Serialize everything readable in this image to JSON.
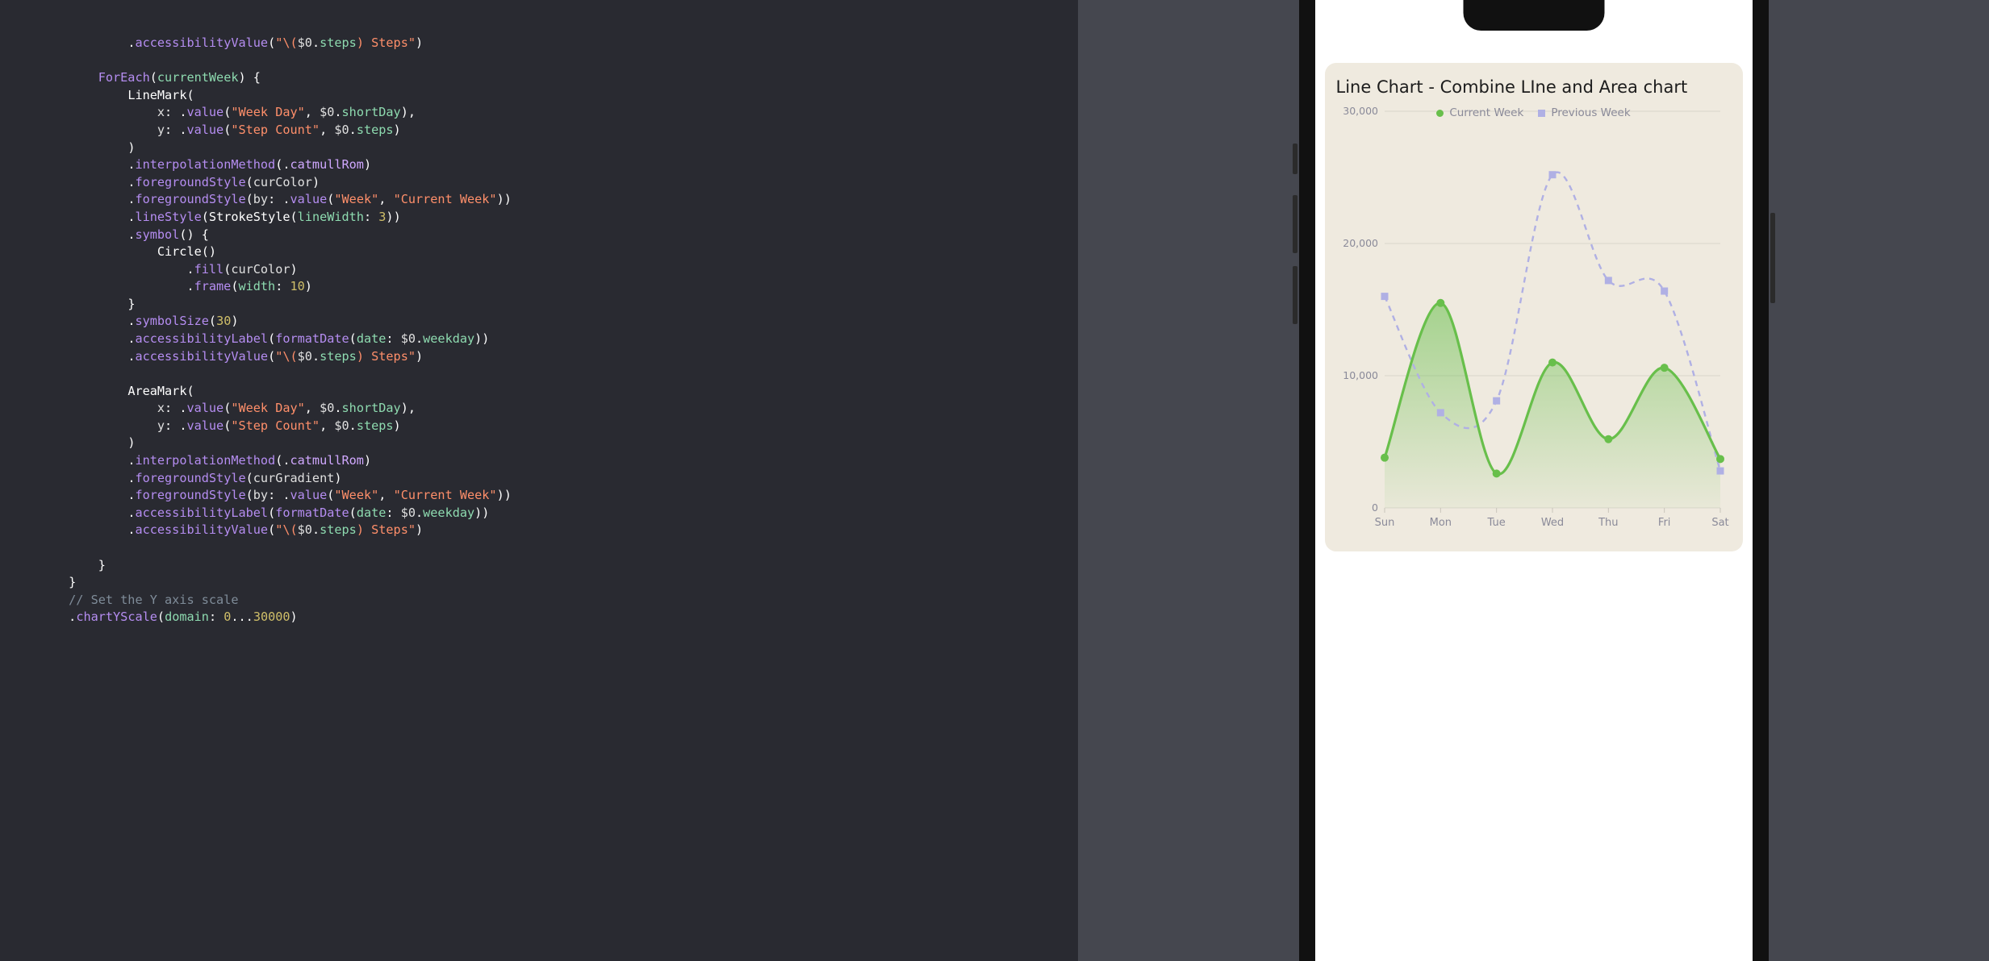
{
  "code": {
    "lines": [
      [
        [
          "                ",
          "punct"
        ],
        [
          ".",
          "punct"
        ],
        [
          "accessibilityValue",
          "fn"
        ],
        [
          "(",
          "punct"
        ],
        [
          "\"\\(",
          "str"
        ],
        [
          "$0",
          "id"
        ],
        [
          ".",
          "punct"
        ],
        [
          "steps",
          "prop"
        ],
        [
          ") Steps\"",
          "str"
        ],
        [
          ")",
          "punct"
        ]
      ],
      [],
      [
        [
          "            ",
          "punct"
        ],
        [
          "ForEach",
          "fn"
        ],
        [
          "(",
          "punct"
        ],
        [
          "currentWeek",
          "prop"
        ],
        [
          ") {",
          "punct"
        ]
      ],
      [
        [
          "                ",
          "punct"
        ],
        [
          "LineMark",
          "swift"
        ],
        [
          "(",
          "punct"
        ]
      ],
      [
        [
          "                    ",
          "punct"
        ],
        [
          "x",
          "id"
        ],
        [
          ": .",
          "punct"
        ],
        [
          "value",
          "fn"
        ],
        [
          "(",
          "punct"
        ],
        [
          "\"Week Day\"",
          "str"
        ],
        [
          ", ",
          "punct"
        ],
        [
          "$0",
          "id"
        ],
        [
          ".",
          "punct"
        ],
        [
          "shortDay",
          "prop"
        ],
        [
          "),",
          "punct"
        ]
      ],
      [
        [
          "                    ",
          "punct"
        ],
        [
          "y",
          "id"
        ],
        [
          ": .",
          "punct"
        ],
        [
          "value",
          "fn"
        ],
        [
          "(",
          "punct"
        ],
        [
          "\"Step Count\"",
          "str"
        ],
        [
          ", ",
          "punct"
        ],
        [
          "$0",
          "id"
        ],
        [
          ".",
          "punct"
        ],
        [
          "steps",
          "prop"
        ],
        [
          ")",
          "punct"
        ]
      ],
      [
        [
          "                ",
          "punct"
        ],
        [
          ")",
          "punct"
        ]
      ],
      [
        [
          "                ",
          "punct"
        ],
        [
          ".",
          "punct"
        ],
        [
          "interpolationMethod",
          "fn"
        ],
        [
          "(.",
          "punct"
        ],
        [
          "catmullRom",
          "enum"
        ],
        [
          ")",
          "punct"
        ]
      ],
      [
        [
          "                ",
          "punct"
        ],
        [
          ".",
          "punct"
        ],
        [
          "foregroundStyle",
          "fn"
        ],
        [
          "(",
          "punct"
        ],
        [
          "curColor",
          "id"
        ],
        [
          ")",
          "punct"
        ]
      ],
      [
        [
          "                ",
          "punct"
        ],
        [
          ".",
          "punct"
        ],
        [
          "foregroundStyle",
          "fn"
        ],
        [
          "(",
          "punct"
        ],
        [
          "by",
          "id"
        ],
        [
          ": .",
          "punct"
        ],
        [
          "value",
          "fn"
        ],
        [
          "(",
          "punct"
        ],
        [
          "\"Week\"",
          "str"
        ],
        [
          ", ",
          "punct"
        ],
        [
          "\"Current Week\"",
          "str"
        ],
        [
          "))",
          "punct"
        ]
      ],
      [
        [
          "                ",
          "punct"
        ],
        [
          ".",
          "punct"
        ],
        [
          "lineStyle",
          "fn"
        ],
        [
          "(",
          "punct"
        ],
        [
          "StrokeStyle",
          "swift"
        ],
        [
          "(",
          "punct"
        ],
        [
          "lineWidth",
          "prop"
        ],
        [
          ": ",
          "punct"
        ],
        [
          "3",
          "num"
        ],
        [
          "))",
          "punct"
        ]
      ],
      [
        [
          "                ",
          "punct"
        ],
        [
          ".",
          "punct"
        ],
        [
          "symbol",
          "fn"
        ],
        [
          "() {",
          "punct"
        ]
      ],
      [
        [
          "                    ",
          "punct"
        ],
        [
          "Circle",
          "swift"
        ],
        [
          "()",
          "punct"
        ]
      ],
      [
        [
          "                        ",
          "punct"
        ],
        [
          ".",
          "punct"
        ],
        [
          "fill",
          "fn"
        ],
        [
          "(",
          "punct"
        ],
        [
          "curColor",
          "id"
        ],
        [
          ")",
          "punct"
        ]
      ],
      [
        [
          "                        ",
          "punct"
        ],
        [
          ".",
          "punct"
        ],
        [
          "frame",
          "fn"
        ],
        [
          "(",
          "punct"
        ],
        [
          "width",
          "prop"
        ],
        [
          ": ",
          "punct"
        ],
        [
          "10",
          "num"
        ],
        [
          ")",
          "punct"
        ]
      ],
      [
        [
          "                ",
          "punct"
        ],
        [
          "}",
          "punct"
        ]
      ],
      [
        [
          "                ",
          "punct"
        ],
        [
          ".",
          "punct"
        ],
        [
          "symbolSize",
          "fn"
        ],
        [
          "(",
          "punct"
        ],
        [
          "30",
          "num"
        ],
        [
          ")",
          "punct"
        ]
      ],
      [
        [
          "                ",
          "punct"
        ],
        [
          ".",
          "punct"
        ],
        [
          "accessibilityLabel",
          "fn"
        ],
        [
          "(",
          "punct"
        ],
        [
          "formatDate",
          "fn"
        ],
        [
          "(",
          "punct"
        ],
        [
          "date",
          "prop"
        ],
        [
          ": ",
          "punct"
        ],
        [
          "$0",
          "id"
        ],
        [
          ".",
          "punct"
        ],
        [
          "weekday",
          "prop"
        ],
        [
          "))",
          "punct"
        ]
      ],
      [
        [
          "                ",
          "punct"
        ],
        [
          ".",
          "punct"
        ],
        [
          "accessibilityValue",
          "fn"
        ],
        [
          "(",
          "punct"
        ],
        [
          "\"\\(",
          "str"
        ],
        [
          "$0",
          "id"
        ],
        [
          ".",
          "punct"
        ],
        [
          "steps",
          "prop"
        ],
        [
          ") Steps\"",
          "str"
        ],
        [
          ")",
          "punct"
        ]
      ],
      [],
      [
        [
          "                ",
          "punct"
        ],
        [
          "AreaMark",
          "swift"
        ],
        [
          "(",
          "punct"
        ]
      ],
      [
        [
          "                    ",
          "punct"
        ],
        [
          "x",
          "id"
        ],
        [
          ": .",
          "punct"
        ],
        [
          "value",
          "fn"
        ],
        [
          "(",
          "punct"
        ],
        [
          "\"Week Day\"",
          "str"
        ],
        [
          ", ",
          "punct"
        ],
        [
          "$0",
          "id"
        ],
        [
          ".",
          "punct"
        ],
        [
          "shortDay",
          "prop"
        ],
        [
          "),",
          "punct"
        ]
      ],
      [
        [
          "                    ",
          "punct"
        ],
        [
          "y",
          "id"
        ],
        [
          ": .",
          "punct"
        ],
        [
          "value",
          "fn"
        ],
        [
          "(",
          "punct"
        ],
        [
          "\"Step Count\"",
          "str"
        ],
        [
          ", ",
          "punct"
        ],
        [
          "$0",
          "id"
        ],
        [
          ".",
          "punct"
        ],
        [
          "steps",
          "prop"
        ],
        [
          ")",
          "punct"
        ]
      ],
      [
        [
          "                ",
          "punct"
        ],
        [
          ")",
          "punct"
        ]
      ],
      [
        [
          "                ",
          "punct"
        ],
        [
          ".",
          "punct"
        ],
        [
          "interpolationMethod",
          "fn"
        ],
        [
          "(.",
          "punct"
        ],
        [
          "catmullRom",
          "enum"
        ],
        [
          ")",
          "punct"
        ]
      ],
      [
        [
          "                ",
          "punct"
        ],
        [
          ".",
          "punct"
        ],
        [
          "foregroundStyle",
          "fn"
        ],
        [
          "(",
          "punct"
        ],
        [
          "curGradient",
          "id"
        ],
        [
          ")",
          "punct"
        ]
      ],
      [
        [
          "                ",
          "punct"
        ],
        [
          ".",
          "punct"
        ],
        [
          "foregroundStyle",
          "fn"
        ],
        [
          "(",
          "punct"
        ],
        [
          "by",
          "id"
        ],
        [
          ": .",
          "punct"
        ],
        [
          "value",
          "fn"
        ],
        [
          "(",
          "punct"
        ],
        [
          "\"Week\"",
          "str"
        ],
        [
          ", ",
          "punct"
        ],
        [
          "\"Current Week\"",
          "str"
        ],
        [
          "))",
          "punct"
        ]
      ],
      [
        [
          "                ",
          "punct"
        ],
        [
          ".",
          "punct"
        ],
        [
          "accessibilityLabel",
          "fn"
        ],
        [
          "(",
          "punct"
        ],
        [
          "formatDate",
          "fn"
        ],
        [
          "(",
          "punct"
        ],
        [
          "date",
          "prop"
        ],
        [
          ": ",
          "punct"
        ],
        [
          "$0",
          "id"
        ],
        [
          ".",
          "punct"
        ],
        [
          "weekday",
          "prop"
        ],
        [
          "))",
          "punct"
        ]
      ],
      [
        [
          "                ",
          "punct"
        ],
        [
          ".",
          "punct"
        ],
        [
          "accessibilityValue",
          "fn"
        ],
        [
          "(",
          "punct"
        ],
        [
          "\"\\(",
          "str"
        ],
        [
          "$0",
          "id"
        ],
        [
          ".",
          "punct"
        ],
        [
          "steps",
          "prop"
        ],
        [
          ") Steps\"",
          "str"
        ],
        [
          ")",
          "punct"
        ]
      ],
      [],
      [
        [
          "            ",
          "punct"
        ],
        [
          "}",
          "punct"
        ]
      ],
      [
        [
          "        ",
          "punct"
        ],
        [
          "}",
          "punct"
        ]
      ],
      [
        [
          "        ",
          "punct"
        ],
        [
          "// Set the Y axis scale",
          "cmt"
        ]
      ],
      [
        [
          "        ",
          "punct"
        ],
        [
          ".",
          "punct"
        ],
        [
          "chartYScale",
          "fn"
        ],
        [
          "(",
          "punct"
        ],
        [
          "domain",
          "prop"
        ],
        [
          ": ",
          "punct"
        ],
        [
          "0",
          "num"
        ],
        [
          "...",
          "punct"
        ],
        [
          "30000",
          "num"
        ],
        [
          ")",
          "punct"
        ]
      ]
    ]
  },
  "card": {
    "title": "Line Chart - Combine LIne and Area chart"
  },
  "legend": {
    "items": [
      {
        "label": "Current Week",
        "shape": "dot",
        "color": "#68bf4b"
      },
      {
        "label": "Previous Week",
        "shape": "sq",
        "color": "#b0b0e4"
      }
    ]
  },
  "colors": {
    "current": "#68bf4b",
    "previous": "#b0b0e4"
  },
  "chart_data": {
    "type": "line",
    "title": "Line Chart - Combine LIne and Area chart",
    "xlabel": "",
    "ylabel": "",
    "ylim": [
      0,
      30000
    ],
    "yticks": [
      0,
      10000,
      20000,
      30000
    ],
    "ytick_labels": [
      "0",
      "10,000",
      "20,000",
      "30,000"
    ],
    "categories": [
      "Sun",
      "Mon",
      "Tue",
      "Wed",
      "Thu",
      "Fri",
      "Sat"
    ],
    "series": [
      {
        "name": "Current Week",
        "kind": "line+area",
        "color": "#68bf4b",
        "symbol": "circle",
        "values": [
          3800,
          15500,
          2600,
          11000,
          5200,
          10600,
          3700
        ]
      },
      {
        "name": "Previous Week",
        "kind": "line-dashed",
        "color": "#b0b0e4",
        "symbol": "square",
        "values": [
          16000,
          7200,
          8100,
          25200,
          17200,
          16400,
          2800
        ]
      }
    ]
  }
}
